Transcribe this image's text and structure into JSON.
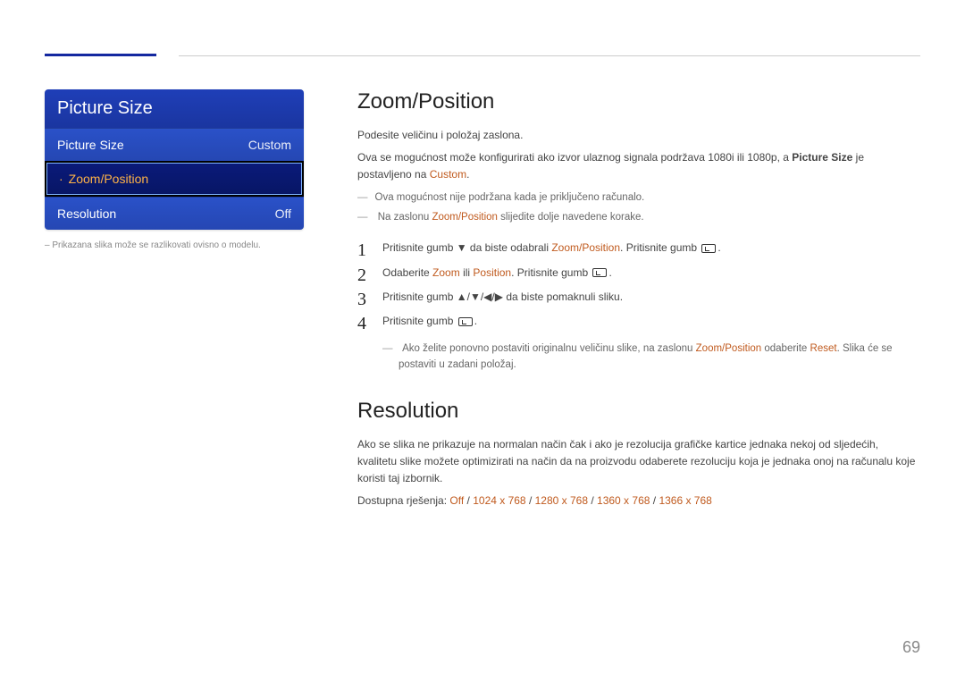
{
  "page_number": "69",
  "sidebar": {
    "menu_title": "Picture Size",
    "rows": [
      {
        "label": "Picture Size",
        "value": "Custom"
      },
      {
        "label": "Zoom/Position",
        "value": ""
      },
      {
        "label": "Resolution",
        "value": "Off"
      }
    ],
    "caption": "– Prikazana slika može se razlikovati ovisno o modelu."
  },
  "content": {
    "sec1": {
      "title": "Zoom/Position",
      "intro": "Podesite veličinu i položaj zaslona.",
      "line2_pre": "Ova se mogućnost može konfigurirati ako izvor ulaznog signala podržava 1080i ili 1080p, a ",
      "line2_bold": "Picture Size",
      "line2_mid": " je postavljeno na ",
      "line2_accent": "Custom",
      "note1": "Ova mogućnost nije podržana kada je priključeno računalo.",
      "note2_pre": "Na zaslonu ",
      "note2_accent": "Zoom/Position",
      "note2_post": " slijedite dolje navedene korake.",
      "steps": {
        "s1_pre": "Pritisnite gumb ",
        "s1_mid": " da biste odabrali ",
        "s1_accent": "Zoom/Position",
        "s1_post": ". Pritisnite gumb ",
        "s2_pre": "Odaberite ",
        "s2_a": "Zoom",
        "s2_or": " ili ",
        "s2_b": "Position",
        "s2_post": ". Pritisnite gumb ",
        "s3_pre": "Pritisnite gumb ",
        "s3_post": " da biste pomaknuli sliku.",
        "s4": "Pritisnite gumb "
      },
      "footnote_pre": "Ako želite ponovno postaviti originalnu veličinu slike, na zaslonu ",
      "footnote_zp": "Zoom/Position",
      "footnote_mid": " odaberite ",
      "footnote_reset": "Reset",
      "footnote_end": ". Slika će se postaviti u zadani položaj."
    },
    "sec2": {
      "title": "Resolution",
      "para": "Ako se slika ne prikazuje na normalan način čak i ako je rezolucija grafičke kartice jednaka nekoj od sljedećih, kvalitetu slike možete optimizirati na način da na proizvodu odaberete rezoluciju koja je jednaka onoj na računalu koje koristi taj izbornik.",
      "avail_label": "Dostupna rješenja: ",
      "opts": [
        "Off",
        "1024 x 768",
        "1280 x 768",
        "1360 x 768",
        "1366 x 768"
      ],
      "sep": " / "
    }
  }
}
